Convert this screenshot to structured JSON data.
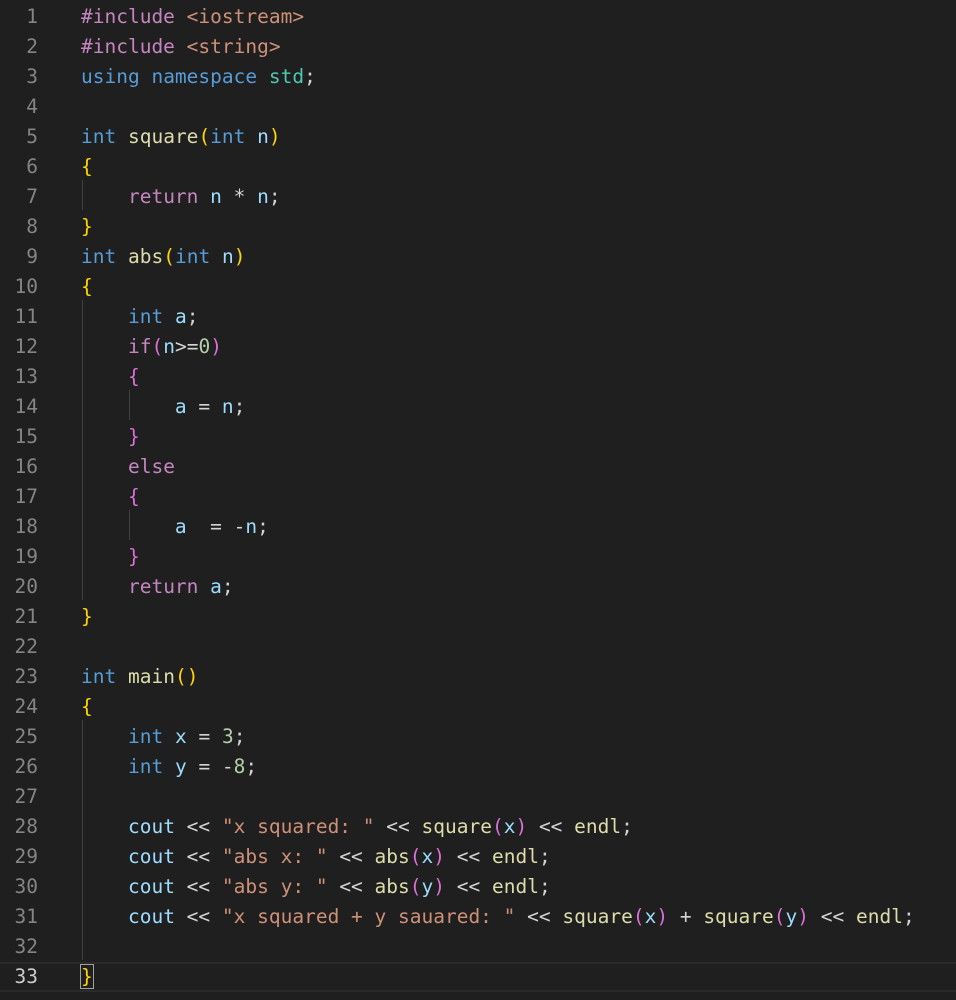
{
  "editor": {
    "current_line": 33,
    "lines": [
      {
        "n": "1",
        "tokens": [
          {
            "t": "#include ",
            "c": "pp"
          },
          {
            "t": "<iostream>",
            "c": "str"
          }
        ]
      },
      {
        "n": "2",
        "tokens": [
          {
            "t": "#include ",
            "c": "pp"
          },
          {
            "t": "<string>",
            "c": "str"
          }
        ]
      },
      {
        "n": "3",
        "tokens": [
          {
            "t": "using",
            "c": "kw"
          },
          {
            "t": " ",
            "c": "p"
          },
          {
            "t": "namespace",
            "c": "kw"
          },
          {
            "t": " ",
            "c": "p"
          },
          {
            "t": "std",
            "c": "ns"
          },
          {
            "t": ";",
            "c": "p"
          }
        ]
      },
      {
        "n": "4",
        "tokens": []
      },
      {
        "n": "5",
        "tokens": [
          {
            "t": "int",
            "c": "kw"
          },
          {
            "t": " ",
            "c": "p"
          },
          {
            "t": "square",
            "c": "fn"
          },
          {
            "t": "(",
            "c": "b1"
          },
          {
            "t": "int",
            "c": "kw"
          },
          {
            "t": " ",
            "c": "p"
          },
          {
            "t": "n",
            "c": "var"
          },
          {
            "t": ")",
            "c": "b1"
          }
        ]
      },
      {
        "n": "6",
        "tokens": [
          {
            "t": "{",
            "c": "b1"
          }
        ]
      },
      {
        "n": "7",
        "tokens": [
          {
            "t": "    ",
            "c": "p"
          },
          {
            "t": "return",
            "c": "ctl"
          },
          {
            "t": " ",
            "c": "p"
          },
          {
            "t": "n",
            "c": "var"
          },
          {
            "t": " * ",
            "c": "p"
          },
          {
            "t": "n",
            "c": "var"
          },
          {
            "t": ";",
            "c": "p"
          }
        ]
      },
      {
        "n": "8",
        "tokens": [
          {
            "t": "}",
            "c": "b1"
          }
        ]
      },
      {
        "n": "9",
        "tokens": [
          {
            "t": "int",
            "c": "kw"
          },
          {
            "t": " ",
            "c": "p"
          },
          {
            "t": "abs",
            "c": "fn"
          },
          {
            "t": "(",
            "c": "b1"
          },
          {
            "t": "int",
            "c": "kw"
          },
          {
            "t": " ",
            "c": "p"
          },
          {
            "t": "n",
            "c": "var"
          },
          {
            "t": ")",
            "c": "b1"
          }
        ]
      },
      {
        "n": "10",
        "tokens": [
          {
            "t": "{",
            "c": "b1"
          }
        ]
      },
      {
        "n": "11",
        "tokens": [
          {
            "t": "    ",
            "c": "p"
          },
          {
            "t": "int",
            "c": "kw"
          },
          {
            "t": " ",
            "c": "p"
          },
          {
            "t": "a",
            "c": "var"
          },
          {
            "t": ";",
            "c": "p"
          }
        ]
      },
      {
        "n": "12",
        "tokens": [
          {
            "t": "    ",
            "c": "p"
          },
          {
            "t": "if",
            "c": "ctl"
          },
          {
            "t": "(",
            "c": "b2"
          },
          {
            "t": "n",
            "c": "var"
          },
          {
            "t": ">=",
            "c": "p"
          },
          {
            "t": "0",
            "c": "num"
          },
          {
            "t": ")",
            "c": "b2"
          }
        ]
      },
      {
        "n": "13",
        "tokens": [
          {
            "t": "    ",
            "c": "p"
          },
          {
            "t": "{",
            "c": "b2"
          }
        ]
      },
      {
        "n": "14",
        "tokens": [
          {
            "t": "        ",
            "c": "p"
          },
          {
            "t": "a",
            "c": "var"
          },
          {
            "t": " = ",
            "c": "p"
          },
          {
            "t": "n",
            "c": "var"
          },
          {
            "t": ";",
            "c": "p"
          }
        ]
      },
      {
        "n": "15",
        "tokens": [
          {
            "t": "    ",
            "c": "p"
          },
          {
            "t": "}",
            "c": "b2"
          }
        ]
      },
      {
        "n": "16",
        "tokens": [
          {
            "t": "    ",
            "c": "p"
          },
          {
            "t": "else",
            "c": "ctl"
          }
        ]
      },
      {
        "n": "17",
        "tokens": [
          {
            "t": "    ",
            "c": "p"
          },
          {
            "t": "{",
            "c": "b2"
          }
        ]
      },
      {
        "n": "18",
        "tokens": [
          {
            "t": "        ",
            "c": "p"
          },
          {
            "t": "a",
            "c": "var"
          },
          {
            "t": "  = -",
            "c": "p"
          },
          {
            "t": "n",
            "c": "var"
          },
          {
            "t": ";",
            "c": "p"
          }
        ]
      },
      {
        "n": "19",
        "tokens": [
          {
            "t": "    ",
            "c": "p"
          },
          {
            "t": "}",
            "c": "b2"
          }
        ]
      },
      {
        "n": "20",
        "tokens": [
          {
            "t": "    ",
            "c": "p"
          },
          {
            "t": "return",
            "c": "ctl"
          },
          {
            "t": " ",
            "c": "p"
          },
          {
            "t": "a",
            "c": "var"
          },
          {
            "t": ";",
            "c": "p"
          }
        ]
      },
      {
        "n": "21",
        "tokens": [
          {
            "t": "}",
            "c": "b1"
          }
        ]
      },
      {
        "n": "22",
        "tokens": []
      },
      {
        "n": "23",
        "tokens": [
          {
            "t": "int",
            "c": "kw"
          },
          {
            "t": " ",
            "c": "p"
          },
          {
            "t": "main",
            "c": "fn"
          },
          {
            "t": "()",
            "c": "b1"
          }
        ]
      },
      {
        "n": "24",
        "tokens": [
          {
            "t": "{",
            "c": "b1"
          }
        ]
      },
      {
        "n": "25",
        "tokens": [
          {
            "t": "    ",
            "c": "p"
          },
          {
            "t": "int",
            "c": "kw"
          },
          {
            "t": " ",
            "c": "p"
          },
          {
            "t": "x",
            "c": "var"
          },
          {
            "t": " = ",
            "c": "p"
          },
          {
            "t": "3",
            "c": "num"
          },
          {
            "t": ";",
            "c": "p"
          }
        ]
      },
      {
        "n": "26",
        "tokens": [
          {
            "t": "    ",
            "c": "p"
          },
          {
            "t": "int",
            "c": "kw"
          },
          {
            "t": " ",
            "c": "p"
          },
          {
            "t": "y",
            "c": "var"
          },
          {
            "t": " = -",
            "c": "p"
          },
          {
            "t": "8",
            "c": "num"
          },
          {
            "t": ";",
            "c": "p"
          }
        ]
      },
      {
        "n": "27",
        "tokens": []
      },
      {
        "n": "28",
        "tokens": [
          {
            "t": "    ",
            "c": "p"
          },
          {
            "t": "cout",
            "c": "var"
          },
          {
            "t": " << ",
            "c": "p"
          },
          {
            "t": "\"x squared: \"",
            "c": "str"
          },
          {
            "t": " << ",
            "c": "p"
          },
          {
            "t": "square",
            "c": "fn"
          },
          {
            "t": "(",
            "c": "b2"
          },
          {
            "t": "x",
            "c": "var"
          },
          {
            "t": ")",
            "c": "b2"
          },
          {
            "t": " << ",
            "c": "p"
          },
          {
            "t": "endl",
            "c": "fn"
          },
          {
            "t": ";",
            "c": "p"
          }
        ]
      },
      {
        "n": "29",
        "tokens": [
          {
            "t": "    ",
            "c": "p"
          },
          {
            "t": "cout",
            "c": "var"
          },
          {
            "t": " << ",
            "c": "p"
          },
          {
            "t": "\"abs x: \"",
            "c": "str"
          },
          {
            "t": " << ",
            "c": "p"
          },
          {
            "t": "abs",
            "c": "fn"
          },
          {
            "t": "(",
            "c": "b2"
          },
          {
            "t": "x",
            "c": "var"
          },
          {
            "t": ")",
            "c": "b2"
          },
          {
            "t": " << ",
            "c": "p"
          },
          {
            "t": "endl",
            "c": "fn"
          },
          {
            "t": ";",
            "c": "p"
          }
        ]
      },
      {
        "n": "30",
        "tokens": [
          {
            "t": "    ",
            "c": "p"
          },
          {
            "t": "cout",
            "c": "var"
          },
          {
            "t": " << ",
            "c": "p"
          },
          {
            "t": "\"abs y: \"",
            "c": "str"
          },
          {
            "t": " << ",
            "c": "p"
          },
          {
            "t": "abs",
            "c": "fn"
          },
          {
            "t": "(",
            "c": "b2"
          },
          {
            "t": "y",
            "c": "var"
          },
          {
            "t": ")",
            "c": "b2"
          },
          {
            "t": " << ",
            "c": "p"
          },
          {
            "t": "endl",
            "c": "fn"
          },
          {
            "t": ";",
            "c": "p"
          }
        ]
      },
      {
        "n": "31",
        "tokens": [
          {
            "t": "    ",
            "c": "p"
          },
          {
            "t": "cout",
            "c": "var"
          },
          {
            "t": " << ",
            "c": "p"
          },
          {
            "t": "\"x squared + y sauared: \"",
            "c": "str"
          },
          {
            "t": " << ",
            "c": "p"
          },
          {
            "t": "square",
            "c": "fn"
          },
          {
            "t": "(",
            "c": "b2"
          },
          {
            "t": "x",
            "c": "var"
          },
          {
            "t": ")",
            "c": "b2"
          },
          {
            "t": " + ",
            "c": "p"
          },
          {
            "t": "square",
            "c": "fn"
          },
          {
            "t": "(",
            "c": "b2"
          },
          {
            "t": "y",
            "c": "var"
          },
          {
            "t": ")",
            "c": "b2"
          },
          {
            "t": " << ",
            "c": "p"
          },
          {
            "t": "endl",
            "c": "fn"
          },
          {
            "t": ";",
            "c": "p"
          }
        ]
      },
      {
        "n": "32",
        "tokens": []
      },
      {
        "n": "33",
        "tokens": [
          {
            "t": "}",
            "c": "b1",
            "box": true
          }
        ]
      }
    ],
    "colors": {
      "background": "#1f1f1f",
      "line_number": "#858585",
      "keyword": "#569cd6",
      "string": "#ce9178",
      "function": "#dcdcaa",
      "variable": "#9cdcfe",
      "control": "#c586c0",
      "number": "#b5cea8",
      "bracket_level_1": "#ffd700",
      "bracket_level_2": "#da70d6"
    }
  }
}
